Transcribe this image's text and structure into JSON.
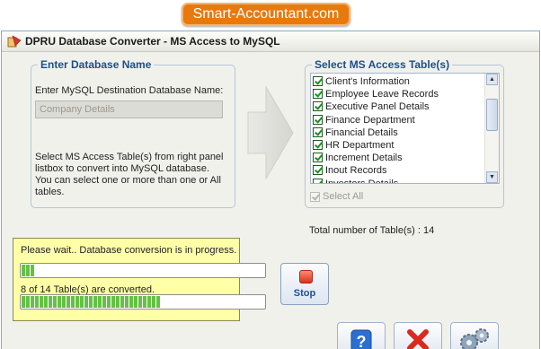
{
  "banner": "Smart-Accountant.com",
  "window": {
    "title": "DPRU  Database Converter - MS Access to MySQL"
  },
  "left_group": {
    "legend": "Enter Database Name",
    "field_label": "Enter MySQL Destination Database Name:",
    "db_name_value": "Company Details",
    "help_text": "Select MS Access Table(s) from right panel listbox to convert into MySQL database. You can select one or more than one or All tables."
  },
  "right_group": {
    "legend": "Select MS Access Table(s)",
    "tables": [
      {
        "label": "Client's Information",
        "checked": true
      },
      {
        "label": "Employee Leave Records",
        "checked": true
      },
      {
        "label": "Executive Panel Details",
        "checked": true
      },
      {
        "label": "Finance Department",
        "checked": true
      },
      {
        "label": "Financial Details",
        "checked": true
      },
      {
        "label": "HR Department",
        "checked": true
      },
      {
        "label": "Increment Details",
        "checked": true
      },
      {
        "label": "Inout Records",
        "checked": true
      },
      {
        "label": "Investors Details",
        "checked": true
      }
    ],
    "select_all_label": "Select All",
    "total_text": "Total number of Table(s) : 14"
  },
  "progress": {
    "status_text": "Please wait.. Database conversion is in progress.",
    "table_progress_fraction": 0.05,
    "count_text": "8 of 14 Table(s) are converted.",
    "overall_progress_fraction": 0.57
  },
  "buttons": {
    "stop_label": "Stop",
    "help_icon": "question-mark-icon",
    "exit_icon": "red-x-icon",
    "settings_icon": "gears-icon"
  },
  "colors": {
    "banner": "#e8790e",
    "legend_text": "#1c4f8a",
    "progress_panel": "#ffffa8",
    "progress_fill": "#63c242",
    "stop_red": "#d9321b"
  }
}
